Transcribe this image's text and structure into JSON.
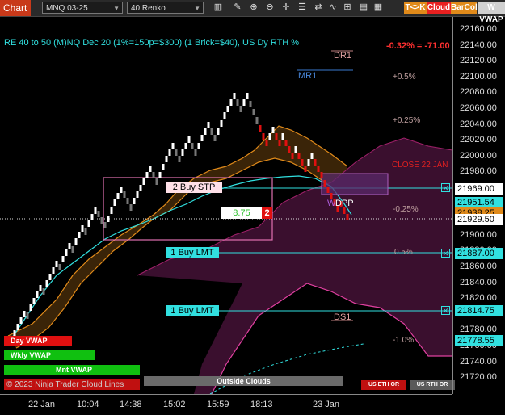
{
  "toolbar": {
    "chart_button": "Chart",
    "instrument": "MNQ 03-25",
    "interval": "40 Renko",
    "icons": [
      "bars-icon",
      "draw-icon",
      "zoom-in-icon",
      "zoom-out-icon",
      "crosshair-icon",
      "properties-icon",
      "strategy-icon",
      "indicators-icon",
      "grid-icon",
      "template-icon",
      "data-box-icon"
    ],
    "pills": {
      "tk": "T<>K",
      "cloud": "Cloud",
      "barcol": "BarCol",
      "vwap": "W VWAP"
    }
  },
  "header": {
    "title": "RE 40 to 50 (M)NQ Dec 20 (1%=150p=$300) (1 Brick=$40), US Dy RTH %",
    "pnl": "-0.32% = -71.00"
  },
  "levels": {
    "dr1": "DR1",
    "mr1": "MR1",
    "p05": "+0.5%",
    "p025": "+0.25%",
    "close": "CLOSE 22 JAN",
    "m025": "-0.25%",
    "m05": "0.5%",
    "ds1": "DS1",
    "m10": "-1.0%",
    "dpp": "DPP",
    "w": "W"
  },
  "orders": [
    {
      "label": "2 Buy STP",
      "price": "21969.00"
    },
    {
      "label": "1 Buy LMT",
      "price": "21887.00"
    },
    {
      "label": "1 Buy LMT",
      "price": "21814.75"
    }
  ],
  "position": {
    "pnl_ticks": "8.75",
    "qty": "2"
  },
  "price_axis": {
    "ticks": [
      "22160.00",
      "22140.00",
      "22120.00",
      "22100.00",
      "22080.00",
      "22060.00",
      "22040.00",
      "22020.00",
      "22000.00",
      "21980.00",
      "21960.00",
      "21940.00",
      "21920.00",
      "21900.00",
      "21880.00",
      "21860.00",
      "21840.00",
      "21820.00",
      "21800.00",
      "21780.00",
      "21760.00",
      "21740.00",
      "21720.00"
    ],
    "tag_cyan": "21951.54",
    "tag_orange": "21938.25",
    "tag_current": "21929.50",
    "tag_bottom": "21778.55"
  },
  "time_axis": [
    "22 Jan",
    "10:04",
    "14:38",
    "15:02",
    "15:59",
    "18:13",
    "23 Jan"
  ],
  "vwap_buttons": {
    "day": "Day VWAP",
    "wkly": "Wkly VWAP",
    "mnt": "Mnt VWAP",
    "copyright": "© 2023 Ninja Trader Cloud Lines"
  },
  "status_buttons": {
    "outside": "Outside Clouds",
    "us_eth": "US ETH OR",
    "us_rth": "US RTH OR"
  },
  "colors": {
    "accent": "#c8391a",
    "cyan": "#31e0e0",
    "orange": "#e08a1a",
    "magenta": "#e040a0",
    "up": "#ffffff",
    "down": "#e01010",
    "cloud_orange": "#3a2408",
    "cloud_magenta": "#3a0f2e"
  }
}
